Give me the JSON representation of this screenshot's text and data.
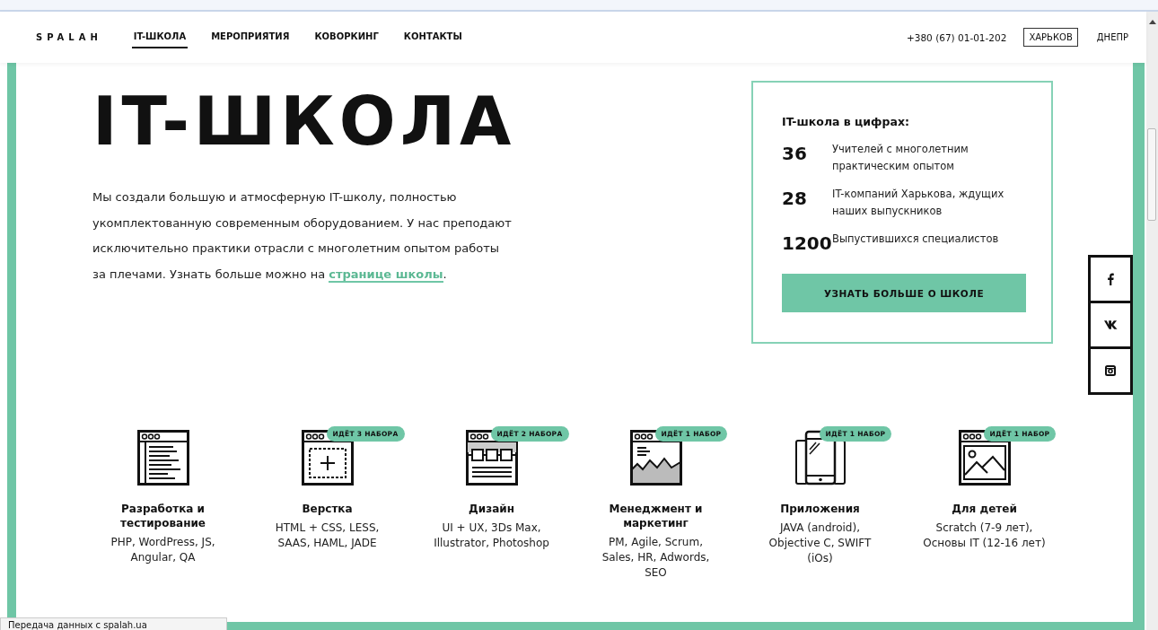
{
  "header": {
    "logo": "SPALAH",
    "nav": [
      {
        "label": "IT-ШКОЛА",
        "selected": true
      },
      {
        "label": "МЕРОПРИЯТИЯ",
        "selected": false
      },
      {
        "label": "КОВОРКИНГ",
        "selected": false
      },
      {
        "label": "КОНТАКТЫ",
        "selected": false
      }
    ],
    "phone": "+380 (67) 01-01-202",
    "cities": [
      {
        "label": "ХАРЬКОВ",
        "selected": true
      },
      {
        "label": "ДНЕПР",
        "selected": false
      }
    ]
  },
  "hero": {
    "title": "IT-ШКОЛА",
    "intro": "Мы создали большую и атмосферную IT-школу, полностью укомплектованную современным оборудованием. У нас преподают исключительно практики отрасли с многолетним опытом работы за плечами. Узнать больше можно на ",
    "link": "странице школы",
    "after": "."
  },
  "stats": {
    "title": "IT-школа в цифрах:",
    "rows": [
      {
        "number": "36",
        "text": "Учителей с многолетним практическим опытом"
      },
      {
        "number": "28",
        "text": "IT-компаний Харькова, ждущих наших выпускников"
      },
      {
        "number": "1200",
        "text": "Выпустившихся специалистов"
      }
    ],
    "button": "УЗНАТЬ БОЛЬШЕ О ШКОЛЕ"
  },
  "social": [
    {
      "kind": "facebook"
    },
    {
      "kind": "vk"
    },
    {
      "kind": "instagram"
    }
  ],
  "courses": [
    {
      "kind": "code",
      "title": "Разработка и тестирование",
      "description": "PHP, WordPress, JS, Angular, QA"
    },
    {
      "kind": "layout",
      "badge": "ИДЁТ 3 НАБОРА",
      "title": "Верстка",
      "description": "HTML + CSS, LESS, SAAS, HAML, JADE"
    },
    {
      "kind": "design",
      "badge": "ИДЁТ 2 НАБОРА",
      "title": "Дизайн",
      "description": "UI + UX, 3Ds Max, Illustrator, Photoshop"
    },
    {
      "kind": "chart",
      "badge": "ИДЁТ 1 НАБОР",
      "title": "Менеджмент и маркетинг",
      "description": "PM, Agile, Scrum, Sales, HR, Adwords, SEO"
    },
    {
      "kind": "mobile",
      "badge": "ИДЁТ 1 НАБОР",
      "title": "Приложения",
      "description": "JAVA (android), Objective C, SWIFT (iOs)"
    },
    {
      "kind": "image",
      "badge": "ИДЁТ 1 НАБОР",
      "title": "Для детей",
      "description": "Scratch (7-9 лет), Основы IT (12-16 лет)"
    }
  ],
  "status_bar": "Передача данных с spalah.ua"
}
